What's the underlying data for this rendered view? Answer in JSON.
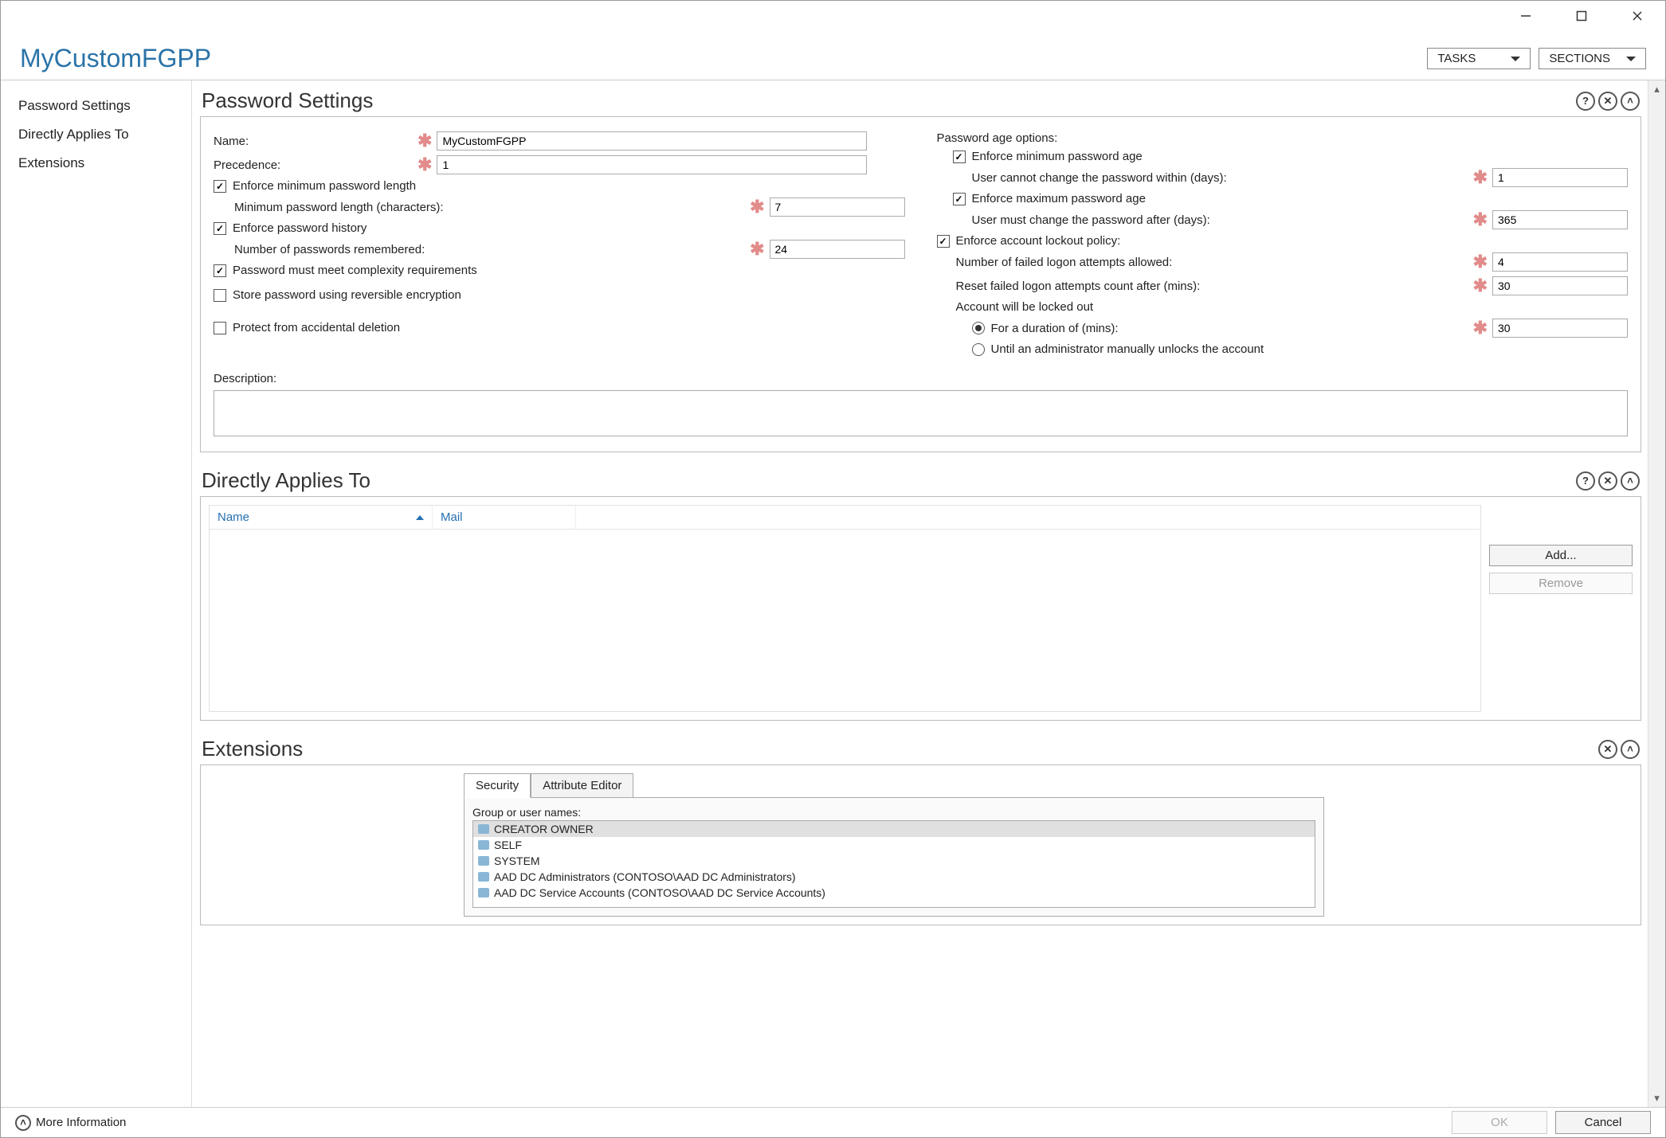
{
  "window": {
    "title": "MyCustomFGPP"
  },
  "header": {
    "tasks_label": "TASKS",
    "sections_label": "SECTIONS"
  },
  "sidebar": {
    "items": [
      {
        "label": "Password Settings"
      },
      {
        "label": "Directly Applies To"
      },
      {
        "label": "Extensions"
      }
    ]
  },
  "password_settings": {
    "section_title": "Password Settings",
    "name_label": "Name:",
    "name_value": "MyCustomFGPP",
    "precedence_label": "Precedence:",
    "precedence_value": "1",
    "enforce_min_len_label": "Enforce minimum password length",
    "enforce_min_len_checked": true,
    "min_len_label": "Minimum password length (characters):",
    "min_len_value": "7",
    "enforce_history_label": "Enforce password history",
    "enforce_history_checked": true,
    "history_count_label": "Number of passwords remembered:",
    "history_count_value": "24",
    "complexity_label": "Password must meet complexity requirements",
    "complexity_checked": true,
    "reversible_label": "Store password using reversible encryption",
    "reversible_checked": false,
    "protect_label": "Protect from accidental deletion",
    "protect_checked": false,
    "description_label": "Description:",
    "description_value": "",
    "age_header": "Password age options:",
    "enforce_min_age_label": "Enforce minimum password age",
    "enforce_min_age_checked": true,
    "min_age_sublabel": "User cannot change the password within (days):",
    "min_age_value": "1",
    "enforce_max_age_label": "Enforce maximum password age",
    "enforce_max_age_checked": true,
    "max_age_sublabel": "User must change the password after (days):",
    "max_age_value": "365",
    "lockout_label": "Enforce account lockout policy:",
    "lockout_checked": true,
    "failed_attempts_label": "Number of failed logon attempts allowed:",
    "failed_attempts_value": "4",
    "reset_after_label": "Reset failed logon attempts count after (mins):",
    "reset_after_value": "30",
    "locked_header": "Account will be locked out",
    "locked_duration_label": "For a duration of (mins):",
    "locked_duration_value": "30",
    "locked_until_admin_label": "Until an administrator manually unlocks the account",
    "locked_radio_selected": "duration"
  },
  "applies_to": {
    "section_title": "Directly Applies To",
    "columns": {
      "name": "Name",
      "mail": "Mail"
    },
    "add_label": "Add...",
    "remove_label": "Remove"
  },
  "extensions": {
    "section_title": "Extensions",
    "tabs": {
      "security": "Security",
      "attribute_editor": "Attribute Editor"
    },
    "group_label": "Group or user names:",
    "principals": [
      "CREATOR OWNER",
      "SELF",
      "SYSTEM",
      "AAD DC Administrators (CONTOSO\\AAD DC Administrators)",
      "AAD DC Service Accounts (CONTOSO\\AAD DC Service Accounts)"
    ]
  },
  "footer": {
    "more_info": "More Information",
    "ok": "OK",
    "cancel": "Cancel"
  }
}
